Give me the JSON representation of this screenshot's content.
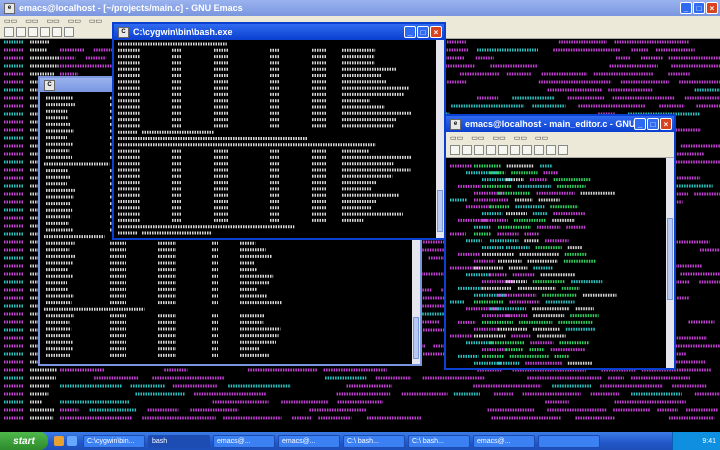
{
  "theme": {
    "magenta": "#c040d0",
    "cyan": "#30c0c0",
    "green": "#30d060",
    "white": "#d6d6d6",
    "title_blue": "#0a3ecf",
    "close_red": "#d8421e"
  },
  "background_window": {
    "title": "emacs@localhost - [~/projects/main.c] - GNU Emacs"
  },
  "terminal_window": {
    "title": "C:\\cygwin\\bin\\bash.exe"
  },
  "cmd_window": {
    "title": "",
    "label": "# ps -eo pid"
  },
  "editor_window": {
    "title": "emacs@localhost - main_editor.c - GNU Emacs"
  },
  "taskbar": {
    "start_label": "start",
    "tasks": [
      "C:\\cygwin\\bin...",
      "bash",
      "emacs@...",
      "emacs@...",
      "C:\\ bash...",
      "C:\\ bash...",
      "emacs@...",
      ""
    ],
    "clock": "9:41"
  }
}
